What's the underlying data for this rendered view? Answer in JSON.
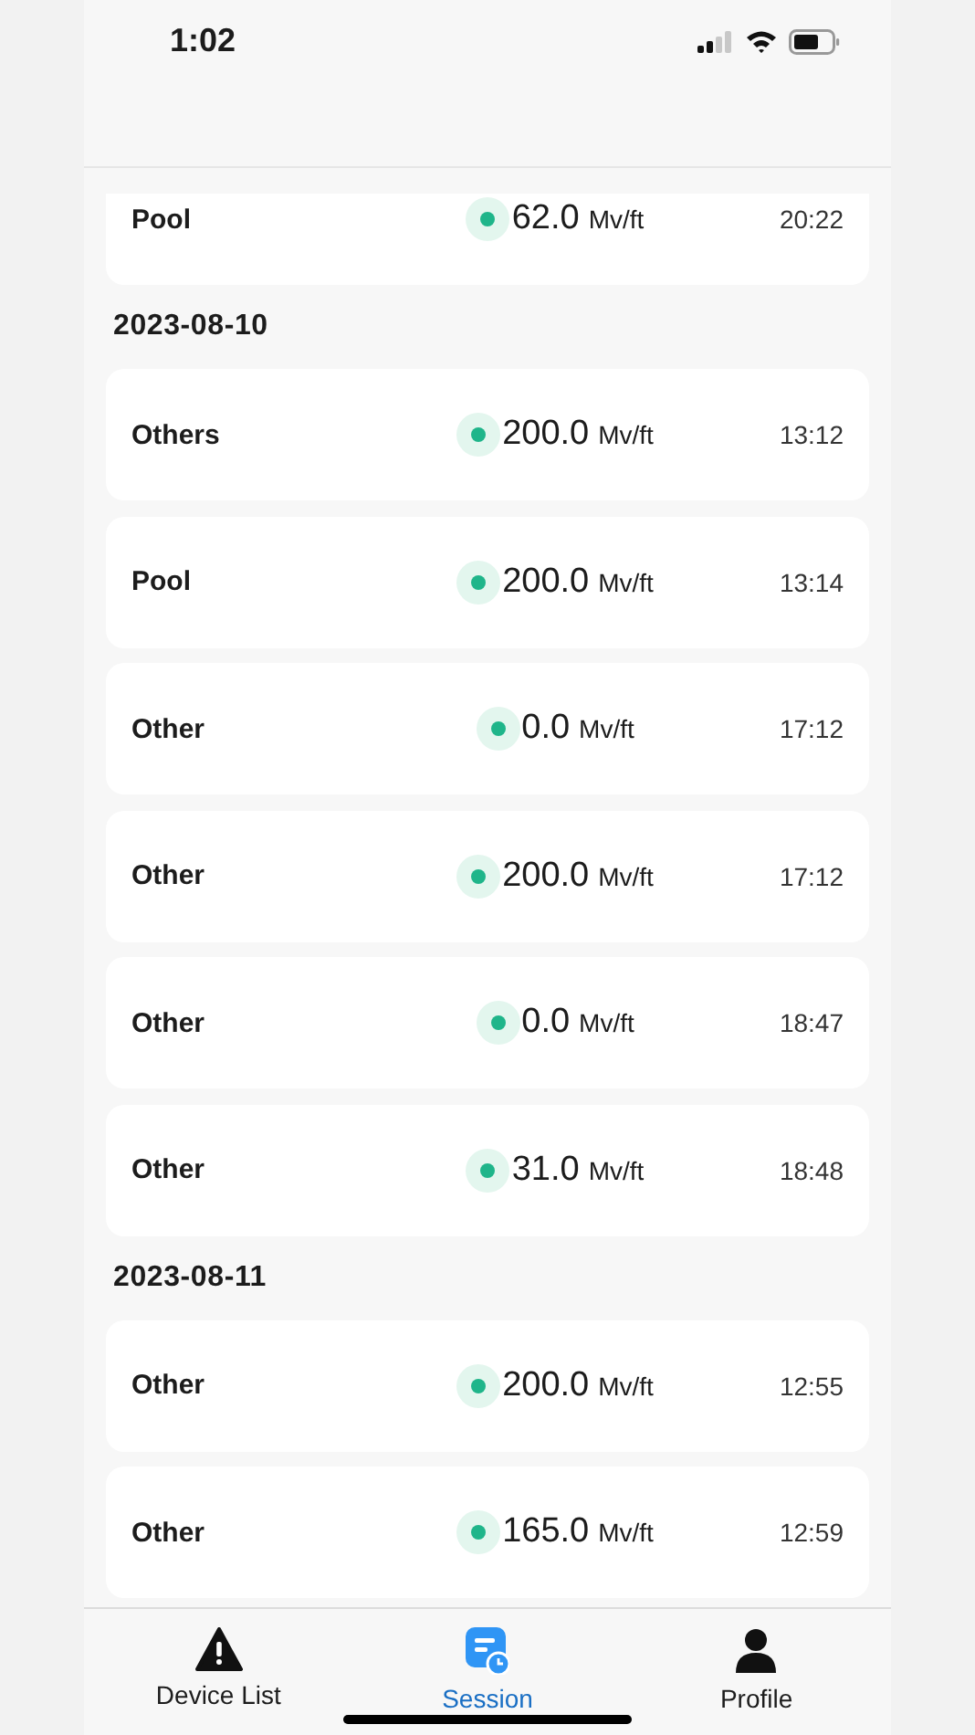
{
  "status_bar": {
    "time": "1:02"
  },
  "groups": [
    {
      "records": [
        {
          "location": "Pool",
          "value": "62.0",
          "unit": "Mv/ft",
          "time": "20:22"
        }
      ]
    },
    {
      "date": "2023-08-10",
      "records": [
        {
          "location": "Others",
          "value": "200.0",
          "unit": "Mv/ft",
          "time": "13:12"
        },
        {
          "location": "Pool",
          "value": "200.0",
          "unit": "Mv/ft",
          "time": "13:14"
        },
        {
          "location": "Other",
          "value": "0.0",
          "unit": "Mv/ft",
          "time": "17:12"
        },
        {
          "location": "Other",
          "value": "200.0",
          "unit": "Mv/ft",
          "time": "17:12"
        },
        {
          "location": "Other",
          "value": "0.0",
          "unit": "Mv/ft",
          "time": "18:47"
        },
        {
          "location": "Other",
          "value": "31.0",
          "unit": "Mv/ft",
          "time": "18:48"
        }
      ]
    },
    {
      "date": "2023-08-11",
      "records": [
        {
          "location": "Other",
          "value": "200.0",
          "unit": "Mv/ft",
          "time": "12:55"
        },
        {
          "location": "Other",
          "value": "165.0",
          "unit": "Mv/ft",
          "time": "12:59"
        }
      ]
    }
  ],
  "tabs": [
    {
      "label": "Device List",
      "selected": false
    },
    {
      "label": "Session",
      "selected": true
    },
    {
      "label": "Profile",
      "selected": false
    }
  ]
}
